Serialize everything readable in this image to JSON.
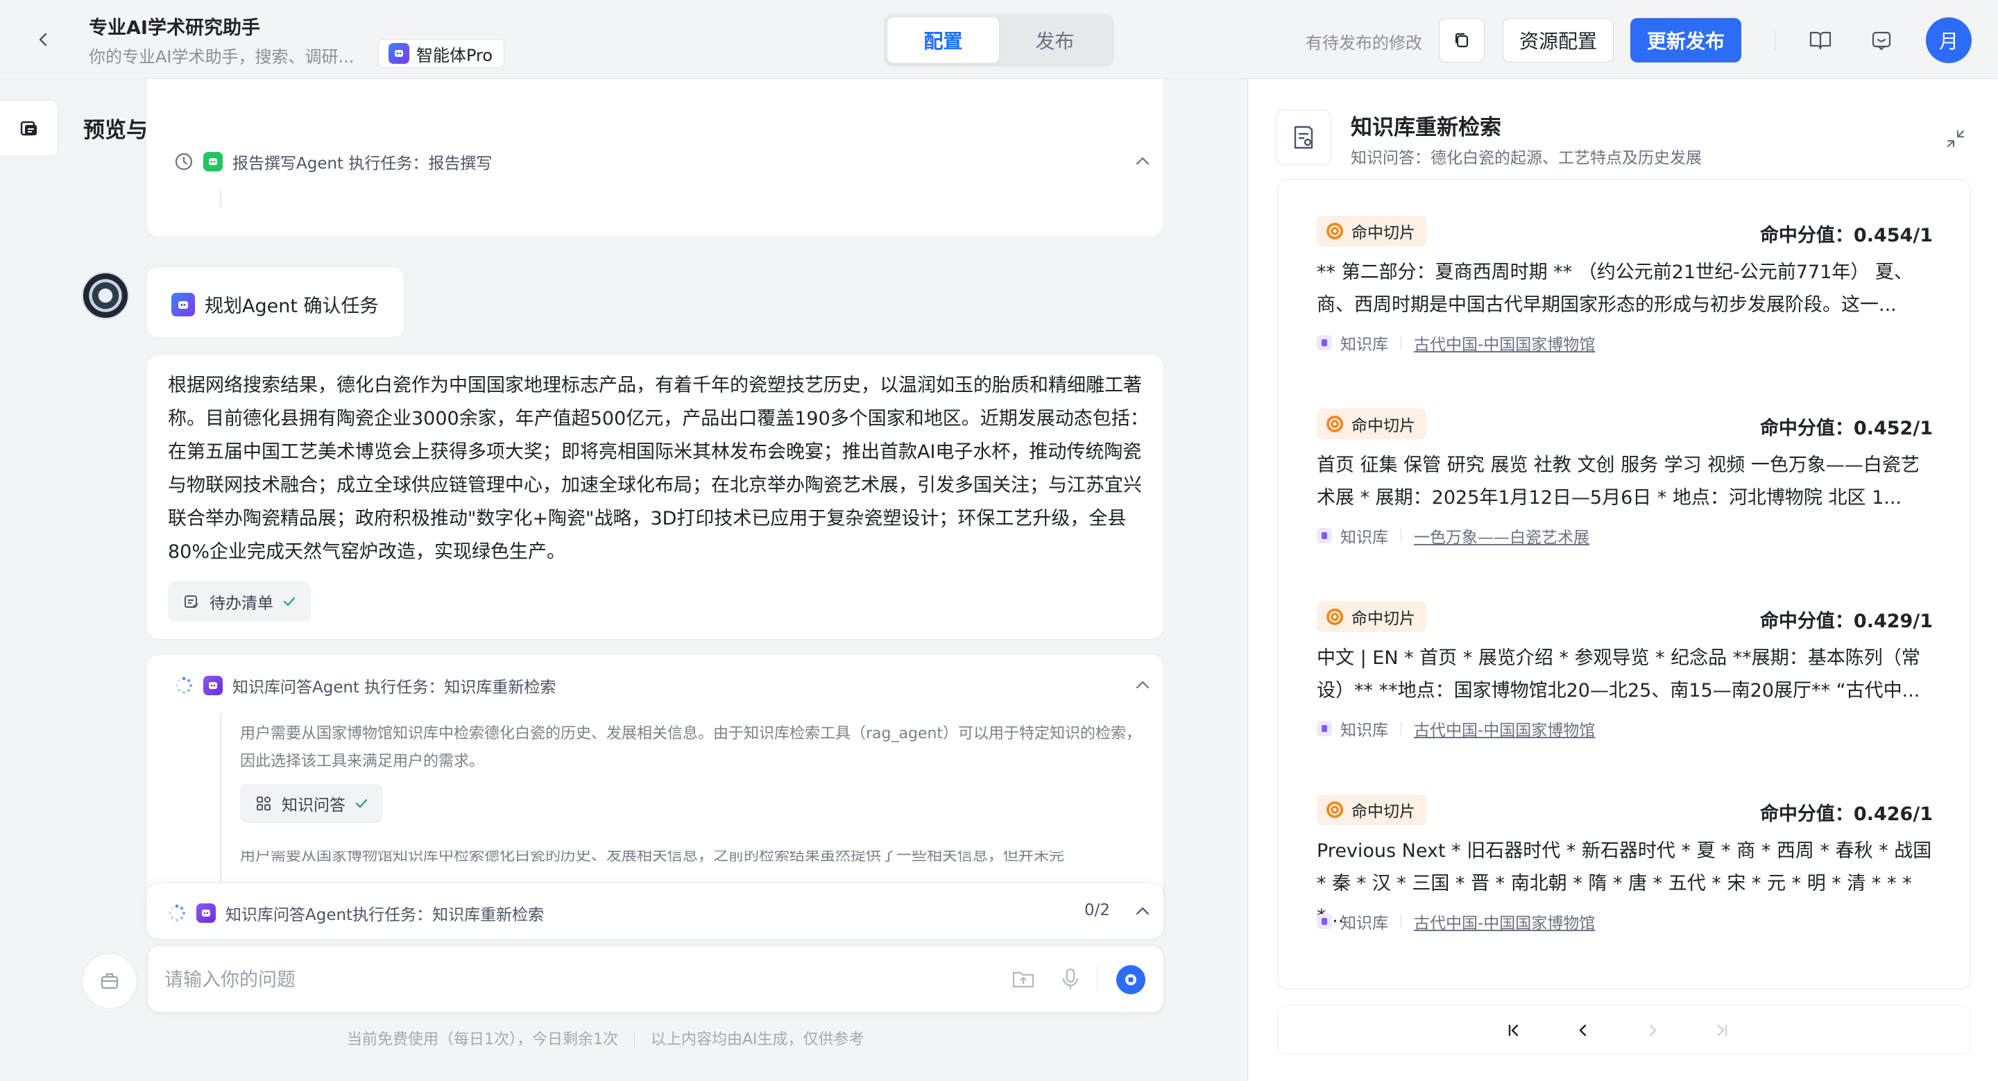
{
  "header": {
    "app_title": "专业AI学术研究助手",
    "app_subtitle": "你的专业AI学术助手，搜索、调研...",
    "pro_badge": "智能体Pro",
    "tabs": [
      {
        "label": "配置",
        "active": true
      },
      {
        "label": "发布",
        "active": false
      }
    ],
    "pending_text": "有待发布的修改",
    "resource_button": "资源配置",
    "update_button": "更新发布",
    "user_avatar": "月",
    "accent_color": "#2d6cf6"
  },
  "left_pane": {
    "title": "预览与调试",
    "file_button": "文件",
    "report_task": "报告撰写Agent 执行任务：报告撰写",
    "planning_label": "规划Agent 确认任务",
    "answer": "根据网络搜索结果，德化白瓷作为中国国家地理标志产品，有着千年的瓷塑技艺历史，以温润如玉的胎质和精细雕工著称。目前德化县拥有陶瓷企业3000余家，年产值超500亿元，产品出口覆盖190多个国家和地区。近期发展动态包括：在第五届中国工艺美术博览会上获得多项大奖；即将亮相国际米其林发布会晚宴；推出首款AI电子水杯，推动传统陶瓷与物联网技术融合；成立全球供应链管理中心，加速全球化布局；在北京举办陶瓷艺术展，引发多国关注；与江苏宜兴联合举办陶瓷精品展；政府积极推动\"数字化+陶瓷\"战略，3D打印技术已应用于复杂瓷塑设计；环保工艺升级，全县80%企业完成天然气窑炉改造，实现绿色生产。",
    "todo_chip": "待办清单",
    "kb_task": "知识库问答Agent 执行任务：知识库重新检索",
    "kb_reason": "用户需要从国家博物馆知识库中检索德化白瓷的历史、发展相关信息。由于知识库检索工具（rag_agent）可以用于特定知识的检索，因此选择该工具来满足用户的需求。",
    "kb_chip": "知识问答",
    "kb_reason_2": "用户需要从国家博物馆知识库中检索德化白瓷的历史、发展相关信息，之前的检索结果虽然提供了一些相关信息，但并未完",
    "bottom_task": "知识库问答Agent执行任务：知识库重新检索",
    "bottom_progress": "0/2",
    "input_placeholder": "请输入你的问题",
    "footer_note_1": "当前免费使用（每日1次），今日剩余1次",
    "footer_note_2": "以上内容均由AI生成，仅供参考"
  },
  "right_pane": {
    "title": "知识库重新检索",
    "subtitle": "知识问答：德化白瓷的起源、工艺特点及历史发展",
    "results": [
      {
        "tag": "命中切片",
        "score": "命中分值：0.454/1",
        "text": "** 第二部分：夏商西周时期 ** （约公元前21世纪-公元前771年） 夏、商、西周时期是中国古代早期国家形态的形成与初步发展阶段。这一...",
        "source_type": "知识库",
        "source_name": "古代中国-中国国家博物馆"
      },
      {
        "tag": "命中切片",
        "score": "命中分值：0.452/1",
        "text": "首页 征集 保管 研究 展览 社教 文创 服务 学习 视频 一色万象——白瓷艺术展 * 展期：2025年1月12日—5月6日 * 地点：河北博物院 北区 1...",
        "source_type": "知识库",
        "source_name": "一色万象——白瓷艺术展"
      },
      {
        "tag": "命中切片",
        "score": "命中分值：0.429/1",
        "text": "中文 | EN * 首页 * 展览介绍 * 参观导览 * 纪念品 **展期：基本陈列（常设）** **地点：国家博物馆北20—北25、南15—南20展厅** “古代中...",
        "source_type": "知识库",
        "source_name": "古代中国-中国国家博物馆"
      },
      {
        "tag": "命中切片",
        "score": "命中分值：0.426/1",
        "text": "Previous Next * 旧石器时代 * 新石器时代 * 夏 * 商 * 西周 * 春秋 * 战国 * 秦 * 汉 * 三国 * 晋 * 南北朝 * 隋 * 唐 * 五代 * 宋 * 元 * 明 * 清 * * * *...",
        "source_type": "知识库",
        "source_name": "古代中国-中国国家博物馆"
      }
    ]
  }
}
